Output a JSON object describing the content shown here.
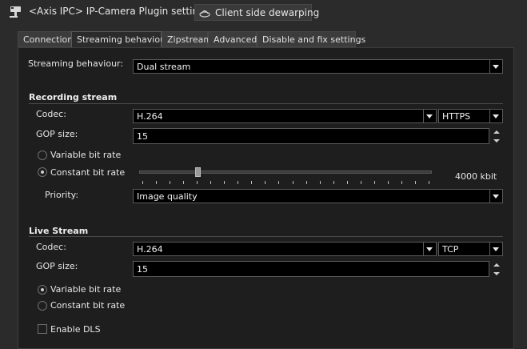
{
  "header": {
    "title": "<Axis IPC> IP-Camera Plugin settings",
    "camera_icon": "camera-icon",
    "dewarp_button": {
      "label": "Client side dewarping",
      "icon": "fisheye-icon"
    }
  },
  "tabs": [
    {
      "label": "Connection",
      "active": false
    },
    {
      "label": "Streaming behaviour",
      "active": true
    },
    {
      "label": "Zipstream",
      "active": false
    },
    {
      "label": "Advanced",
      "active": false
    },
    {
      "label": "Disable and fix settings",
      "active": false
    }
  ],
  "streaming_behaviour": {
    "label": "Streaming behaviour:",
    "value": "Dual stream"
  },
  "recording_stream": {
    "section_title": "Recording stream",
    "codec_label": "Codec:",
    "codec_value": "H.264",
    "protocol_value": "HTTPS",
    "gop_label": "GOP size:",
    "gop_value": "15",
    "variable_bitrate_label": "Variable bit rate",
    "constant_bitrate_label": "Constant bit rate",
    "selected_bitrate_mode": "constant",
    "bitrate_value": "4000 kbit",
    "slider_fraction": 0.2,
    "priority_label": "Priority:",
    "priority_value": "Image quality"
  },
  "live_stream": {
    "section_title": "Live Stream",
    "codec_label": "Codec:",
    "codec_value": "H.264",
    "protocol_value": "TCP",
    "gop_label": "GOP size:",
    "gop_value": "15",
    "variable_bitrate_label": "Variable bit rate",
    "constant_bitrate_label": "Constant bit rate",
    "selected_bitrate_mode": "variable",
    "enable_dls_label": "Enable DLS",
    "enable_dls_checked": false
  }
}
